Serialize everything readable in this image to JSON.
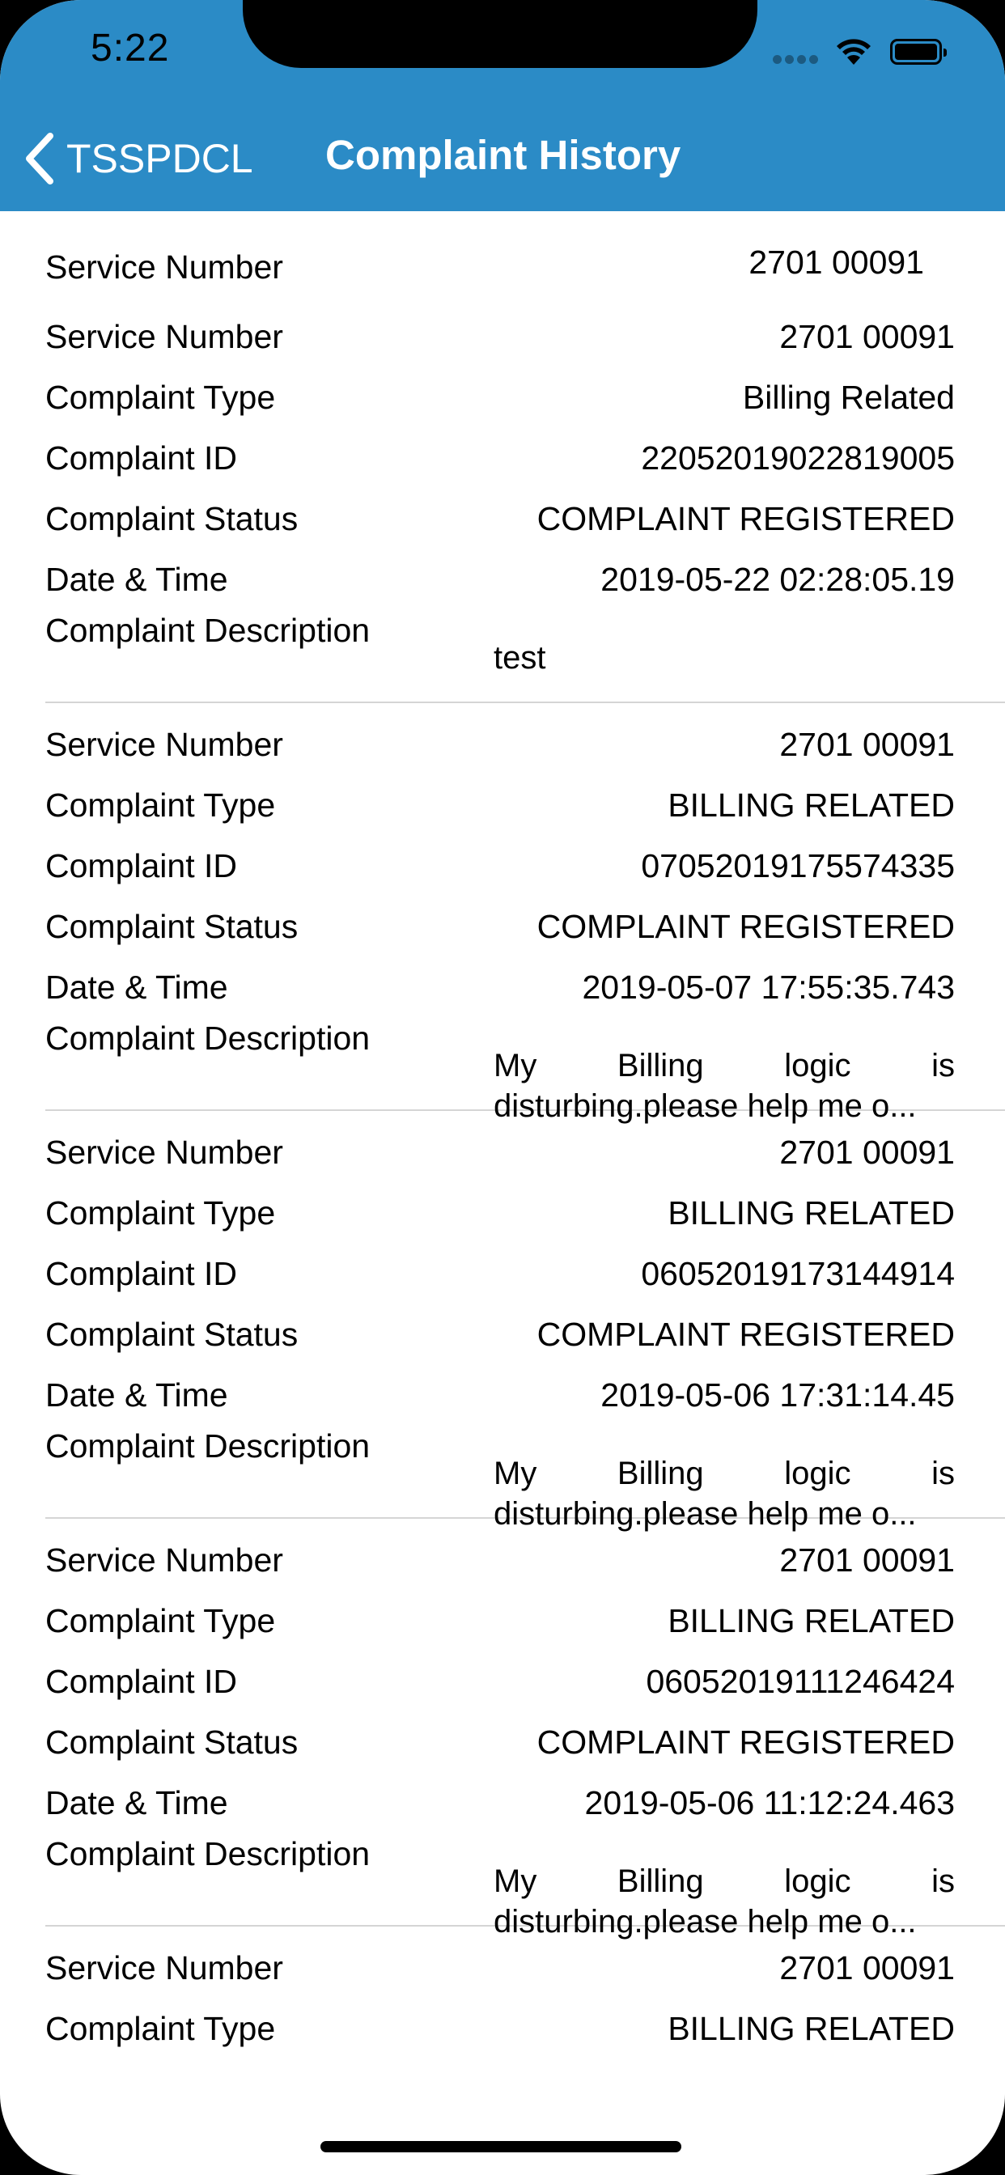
{
  "status_bar": {
    "time": "5:22"
  },
  "nav": {
    "back_label": "TSSPDCL",
    "title": "Complaint History"
  },
  "top_field": {
    "label": "Service Number",
    "value": "2701 00091"
  },
  "labels": {
    "service_number": "Service Number",
    "complaint_type": "Complaint Type",
    "complaint_id": "Complaint ID",
    "complaint_status": "Complaint Status",
    "date_time": "Date & Time",
    "complaint_description": "Complaint Description"
  },
  "complaints": [
    {
      "service_number": "2701 00091",
      "complaint_type": "Billing Related",
      "complaint_id": "22052019022819005",
      "complaint_status": "COMPLAINT REGISTERED",
      "date_time": "2019-05-22 02:28:05.19",
      "description": "test"
    },
    {
      "service_number": "2701 00091",
      "complaint_type": "BILLING RELATED",
      "complaint_id": "07052019175574335",
      "complaint_status": "COMPLAINT REGISTERED",
      "date_time": "2019-05-07 17:55:35.743",
      "description_words": [
        "My",
        "Billing",
        "logic",
        "is"
      ],
      "description_line2": "disturbing.please help me o..."
    },
    {
      "service_number": "2701 00091",
      "complaint_type": "BILLING RELATED",
      "complaint_id": "06052019173144914",
      "complaint_status": "COMPLAINT REGISTERED",
      "date_time": "2019-05-06 17:31:14.45",
      "description_words": [
        "My",
        "Billing",
        "logic",
        "is"
      ],
      "description_line2": "disturbing.please help me o..."
    },
    {
      "service_number": "2701 00091",
      "complaint_type": "BILLING RELATED",
      "complaint_id": "06052019111246424",
      "complaint_status": "COMPLAINT REGISTERED",
      "date_time": "2019-05-06 11:12:24.463",
      "description_words": [
        "My",
        "Billing",
        "logic",
        "is"
      ],
      "description_line2": "disturbing.please help me o..."
    },
    {
      "service_number": "2701 00091",
      "complaint_type": "BILLING RELATED"
    }
  ]
}
